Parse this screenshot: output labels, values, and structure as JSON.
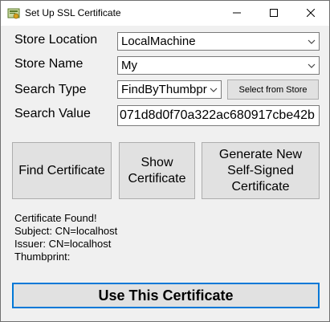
{
  "window": {
    "title": "Set Up SSL Certificate"
  },
  "form": {
    "store_location_label": "Store Location",
    "store_location_value": "LocalMachine",
    "store_name_label": "Store Name",
    "store_name_value": "My",
    "search_type_label": "Search Type",
    "search_type_value": "FindByThumbpr",
    "select_from_store_label": "Select from Store",
    "search_value_label": "Search Value",
    "search_value_text": "071d8d0f70a322ac680917cbe42b"
  },
  "actions": {
    "find_label": "Find Certificate",
    "show_line1": "Show",
    "show_line2": "Certificate",
    "generate_line1": "Generate New",
    "generate_line2": "Self-Signed",
    "generate_line3": "Certificate",
    "use_label": "Use This Certificate"
  },
  "status": {
    "line1": "Certificate Found!",
    "line2": "Subject: CN=localhost",
    "line3": "Issuer: CN=localhost",
    "line4": "Thumbprint:"
  },
  "icons": {
    "app": "certificate-icon",
    "minimize": "minimize-icon",
    "maximize": "maximize-icon",
    "close": "close-icon",
    "dropdown": "chevron-down-icon"
  }
}
